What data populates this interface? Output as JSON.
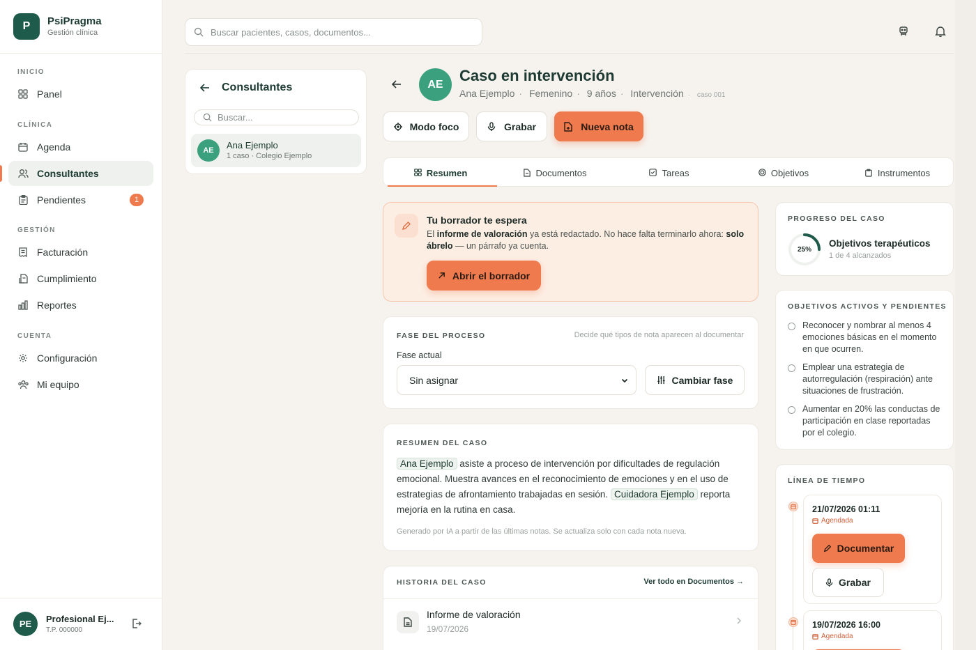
{
  "brand": {
    "logo_letter": "P",
    "name": "PsiPragma",
    "subtitle": "Gestión clínica"
  },
  "sidebar": {
    "sections": [
      {
        "title": "INICIO",
        "items": [
          {
            "label": "Panel",
            "icon": "grid-icon"
          }
        ]
      },
      {
        "title": "CLÍNICA",
        "items": [
          {
            "label": "Agenda",
            "icon": "calendar-icon"
          },
          {
            "label": "Consultantes",
            "icon": "users-icon",
            "active": true
          },
          {
            "label": "Pendientes",
            "icon": "clipboard-icon",
            "badge": "1"
          }
        ]
      },
      {
        "title": "GESTIÓN",
        "items": [
          {
            "label": "Facturación",
            "icon": "receipt-icon"
          },
          {
            "label": "Cumplimiento",
            "icon": "shield-doc-icon"
          },
          {
            "label": "Reportes",
            "icon": "bar-chart-icon"
          }
        ]
      },
      {
        "title": "CUENTA",
        "items": [
          {
            "label": "Configuración",
            "icon": "gear-icon"
          },
          {
            "label": "Mi equipo",
            "icon": "team-icon"
          }
        ]
      }
    ],
    "profile": {
      "initials": "PE",
      "name": "Profesional Ej...",
      "license": "T.P. 000000"
    }
  },
  "topbar": {
    "search_placeholder": "Buscar pacientes, casos, documentos..."
  },
  "consultants_panel": {
    "title": "Consultantes",
    "search_placeholder": "Buscar...",
    "items": [
      {
        "initials": "AE",
        "name": "Ana Ejemplo",
        "meta": "1 caso · Colegio Ejemplo"
      }
    ]
  },
  "case": {
    "initials": "AE",
    "title": "Caso en intervención",
    "meta": {
      "name": "Ana Ejemplo",
      "gender": "Femenino",
      "age": "9 años",
      "phase": "Intervención",
      "case_no": "caso 001"
    },
    "actions": {
      "focus": "Modo foco",
      "record": "Grabar",
      "new_note": "Nueva nota"
    }
  },
  "tabs": [
    {
      "label": "Resumen",
      "icon": "grid-icon",
      "active": true
    },
    {
      "label": "Documentos",
      "icon": "file-icon"
    },
    {
      "label": "Tareas",
      "icon": "check-square-icon"
    },
    {
      "label": "Objetivos",
      "icon": "target-icon"
    },
    {
      "label": "Instrumentos",
      "icon": "clipboard-icon"
    }
  ],
  "draft": {
    "title": "Tu borrador te espera",
    "body_1": "El ",
    "body_bold_1": "informe de valoración",
    "body_2": " ya está redactado. No hace falta terminarlo ahora: ",
    "body_bold_2": "solo ábrelo",
    "body_3": " — un párrafo ya cuenta.",
    "cta": "Abrir el borrador"
  },
  "phase": {
    "caption": "FASE DEL PROCESO",
    "hint": "Decide qué tipos de nota aparecen al documentar",
    "field_label": "Fase actual",
    "selected": "Sin asignar",
    "change_button": "Cambiar fase"
  },
  "summary": {
    "caption": "RESUMEN DEL CASO",
    "chip_1": "Ana Ejemplo",
    "text_1": " asiste a proceso de intervención por dificultades de regulación emocional. Muestra avances en el reconocimiento de emociones y en el uso de estrategias de afrontamiento trabajadas en sesión. ",
    "chip_2": "Cuidadora Ejemplo",
    "text_2": " reporta mejoría en la rutina en casa.",
    "footnote": "Generado por IA a partir de las últimas notas. Se actualiza solo con cada nota nueva."
  },
  "history": {
    "caption": "HISTORIA DEL CASO",
    "link": "Ver todo en Documentos →",
    "items": [
      {
        "title": "Informe de valoración",
        "date": "19/07/2026"
      }
    ]
  },
  "progress": {
    "caption": "PROGRESO DEL CASO",
    "percent_label": "25%",
    "fraction": 0.25,
    "title": "Objetivos terapéuticos",
    "subtitle": "1 de 4 alcanzados"
  },
  "objectives": {
    "caption": "OBJETIVOS ACTIVOS Y PENDIENTES",
    "items": [
      "Reconocer y nombrar al menos 4 emociones básicas en el momento en que ocurren.",
      "Emplear una estrategia de autorregulación (respiración) ante situaciones de frustración.",
      "Aumentar en 20% las conductas de participación en clase reportadas por el colegio."
    ]
  },
  "timeline": {
    "caption": "LÍNEA DE TIEMPO",
    "events": [
      {
        "datetime": "21/07/2026 01:11",
        "status": "Agendada",
        "primary_action": "Documentar",
        "secondary_action": "Grabar"
      },
      {
        "datetime": "19/07/2026 16:00",
        "status": "Agendada"
      }
    ]
  },
  "colors": {
    "primary": "#1e5b4a",
    "accent": "#ee7a4d",
    "avatar": "#3aa07d"
  }
}
